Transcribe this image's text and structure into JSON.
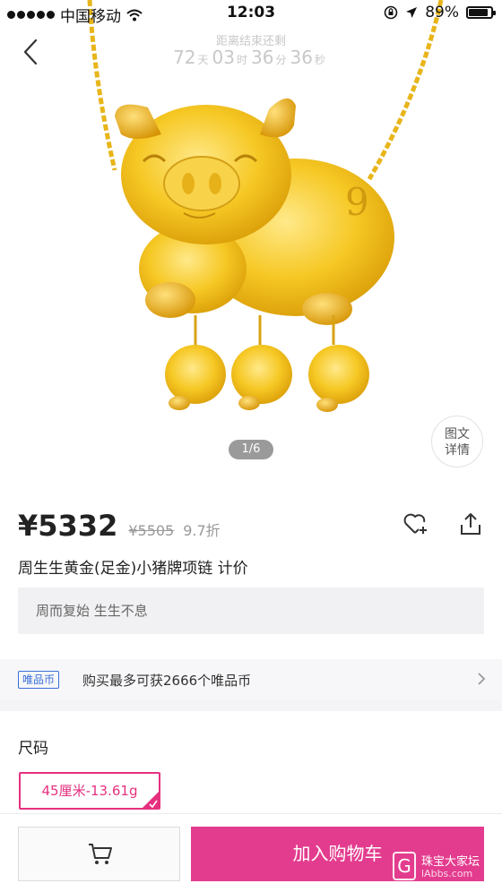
{
  "status_bar": {
    "carrier": "中国移动",
    "time": "12:03",
    "battery": "89%",
    "battery_level": 0.89
  },
  "header": {
    "countdown_label": "距离结束还剩",
    "countdown": {
      "days": "72",
      "days_unit": "天",
      "hours": "03",
      "hours_unit": "时",
      "minutes": "36",
      "minutes_unit": "分",
      "seconds": "36",
      "seconds_unit": "秒"
    }
  },
  "gallery": {
    "page_indicator": "1/6",
    "detail_button": "图文\n详情"
  },
  "product": {
    "price": "¥5332",
    "original_price": "¥5505",
    "discount": "9.7折",
    "title": "周生生黄金(足金)小猪牌项链 计价",
    "slogan": "周而复始 生生不息"
  },
  "coins": {
    "badge": "唯品币",
    "text": "购买最多可获2666个唯品币"
  },
  "size": {
    "label": "尺码",
    "selected_option": "45厘米-13.61g"
  },
  "bottom_bar": {
    "add_to_cart": "加入购物车"
  },
  "watermark": {
    "text": "珠宝大家坛",
    "url": "lAbbs.com"
  },
  "colors": {
    "accent": "#e33c8e",
    "gold": "#f4c21f",
    "coin_blue": "#3a6fd8"
  }
}
